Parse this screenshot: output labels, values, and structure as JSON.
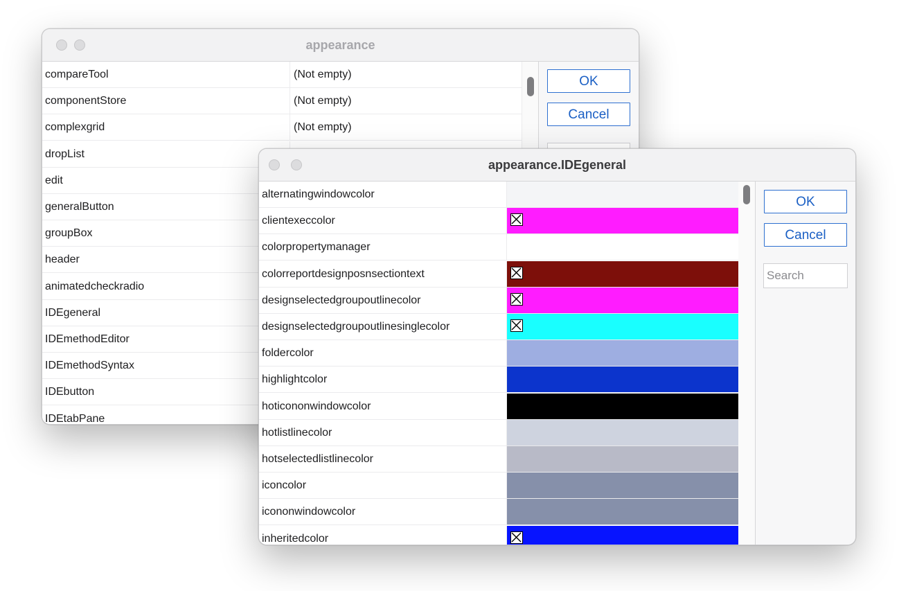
{
  "back_window": {
    "title": "appearance",
    "rows": [
      {
        "name": "compareTool",
        "value": "(Not empty)"
      },
      {
        "name": "componentStore",
        "value": "(Not empty)"
      },
      {
        "name": "complexgrid",
        "value": "(Not empty)"
      },
      {
        "name": "dropList",
        "value": ""
      },
      {
        "name": "edit",
        "value": ""
      },
      {
        "name": "generalButton",
        "value": ""
      },
      {
        "name": "groupBox",
        "value": ""
      },
      {
        "name": "header",
        "value": ""
      },
      {
        "name": "animatedcheckradio",
        "value": ""
      },
      {
        "name": "IDEgeneral",
        "value": ""
      },
      {
        "name": "IDEmethodEditor",
        "value": ""
      },
      {
        "name": "IDEmethodSyntax",
        "value": ""
      },
      {
        "name": "IDEbutton",
        "value": ""
      },
      {
        "name": "IDEtabPane",
        "value": ""
      }
    ],
    "ok_label": "OK",
    "cancel_label": "Cancel"
  },
  "front_window": {
    "title": "appearance.IDEgeneral",
    "rows": [
      {
        "name": "alternatingwindowcolor",
        "color": "#f4f5f7",
        "checkbox": false
      },
      {
        "name": "clientexeccolor",
        "color": "#ff1cff",
        "checkbox": true
      },
      {
        "name": "colorpropertymanager",
        "color": "#ffffff",
        "checkbox": false
      },
      {
        "name": "colorreportdesignposnsectiontext",
        "color": "#7d0f0a",
        "checkbox": true
      },
      {
        "name": "designselectedgroupoutlinecolor",
        "color": "#ff1cff",
        "checkbox": true
      },
      {
        "name": "designselectedgroupoutlinesinglecolor",
        "color": "#19ffff",
        "checkbox": true
      },
      {
        "name": "foldercolor",
        "color": "#9eaee1",
        "checkbox": false
      },
      {
        "name": "highlightcolor",
        "color": "#0c34cc",
        "checkbox": false
      },
      {
        "name": "hoticononwindowcolor",
        "color": "#000000",
        "checkbox": false
      },
      {
        "name": "hotlistlinecolor",
        "color": "#ced3df",
        "checkbox": false
      },
      {
        "name": "hotselectedlistlinecolor",
        "color": "#b8bac7",
        "checkbox": false
      },
      {
        "name": "iconcolor",
        "color": "#8690aa",
        "checkbox": false
      },
      {
        "name": "icononwindowcolor",
        "color": "#8690aa",
        "checkbox": false
      },
      {
        "name": "inheritedcolor",
        "color": "#0714ff",
        "checkbox": true
      }
    ],
    "ok_label": "OK",
    "cancel_label": "Cancel",
    "search_placeholder": "Search"
  }
}
